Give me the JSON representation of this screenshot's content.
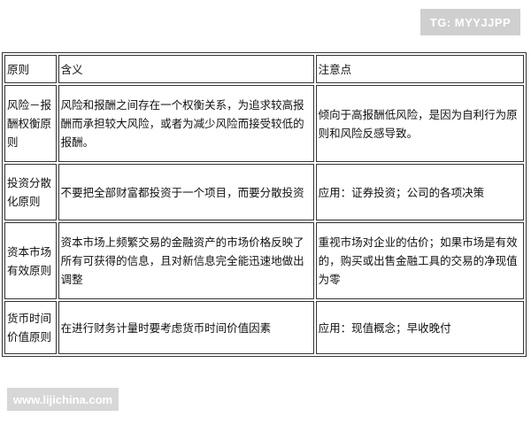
{
  "watermark_top": "TG: MYYJJPP",
  "watermark_bottom": "www.lijichina.com",
  "table": {
    "headers": [
      "原则",
      "含义",
      "注意点"
    ],
    "rows": [
      {
        "principle": "风险－报酬权衡原则",
        "meaning": "风险和报酬之间存在一个权衡关系，为追求较高报酬而承担较大风险，或者为减少风险而接受较低的报酬。",
        "notes": "倾向于高报酬低风险，是因为自利行为原则和风险反感导致。"
      },
      {
        "principle": "投资分散化原则",
        "meaning": "不要把全部财富都投资于一个项目，而要分散投资",
        "notes": "应用：证券投资；公司的各项决策"
      },
      {
        "principle": "资本市场有效原则",
        "meaning": "资本市场上频繁交易的金融资产的市场价格反映了所有可获得的信息，且对新信息完全能迅速地做出调整",
        "notes": "重视市场对企业的估价；如果市场是有效的，购买或出售金融工具的交易的净现值为零"
      },
      {
        "principle": "货币时间价值原则",
        "meaning": "在进行财务计量时要考虑货币时间价值因素",
        "notes": "应用：现值概念；早收晚付"
      }
    ]
  }
}
